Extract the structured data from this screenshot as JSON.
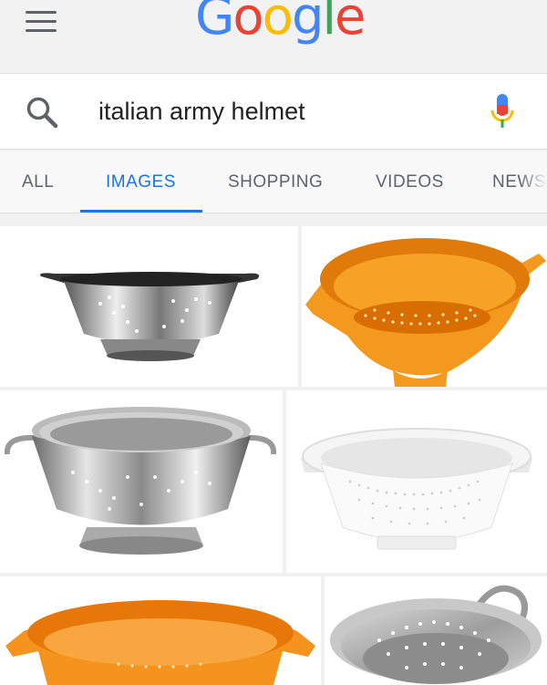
{
  "header": {
    "logo_letters": [
      {
        "char": "G",
        "color": "#4285f4"
      },
      {
        "char": "o",
        "color": "#ea4335"
      },
      {
        "char": "o",
        "color": "#fbbc05"
      },
      {
        "char": "g",
        "color": "#4285f4"
      },
      {
        "char": "l",
        "color": "#34a853"
      },
      {
        "char": "e",
        "color": "#ea4335"
      }
    ],
    "menu_icon": "hamburger-menu-icon"
  },
  "search": {
    "query": "italian army helmet",
    "search_icon": "search-icon",
    "voice_icon": "microphone-icon"
  },
  "tabs": {
    "all": "ALL",
    "images": "IMAGES",
    "shopping": "SHOPPING",
    "videos": "VIDEOS",
    "news": "NEWS",
    "active": "IMAGES",
    "accent_color": "#1a73e8"
  },
  "results": [
    {
      "subject": "stainless-steel-colander"
    },
    {
      "subject": "orange-plastic-colander"
    },
    {
      "subject": "stainless-steel-colander-footed"
    },
    {
      "subject": "white-plastic-colander"
    },
    {
      "subject": "orange-plastic-colander"
    },
    {
      "subject": "stainless-steel-colander"
    }
  ]
}
